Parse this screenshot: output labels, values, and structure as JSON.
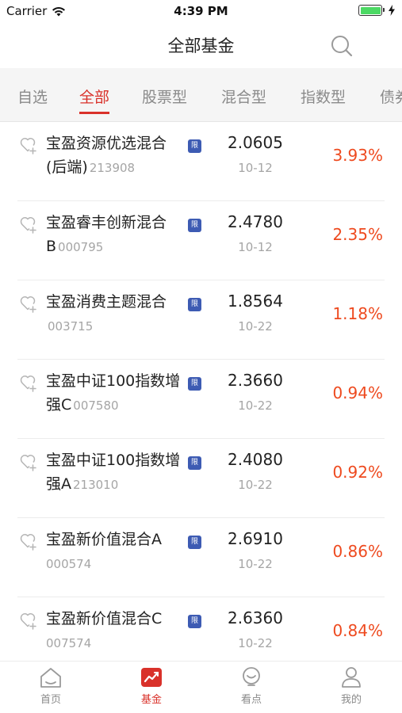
{
  "status_bar": {
    "carrier": "Carrier",
    "time": "4:39 PM"
  },
  "header": {
    "title": "全部基金"
  },
  "tabs": [
    {
      "label": "自选",
      "active": false
    },
    {
      "label": "全部",
      "active": true
    },
    {
      "label": "股票型",
      "active": false
    },
    {
      "label": "混合型",
      "active": false
    },
    {
      "label": "指数型",
      "active": false
    },
    {
      "label": "债券",
      "active": false
    }
  ],
  "funds": [
    {
      "name": "宝盈资源优选混合(后端)",
      "code": "213908",
      "badge": "限",
      "nav": "2.0605",
      "date": "10-12",
      "change": "3.93%"
    },
    {
      "name": "宝盈睿丰创新混合B",
      "code": "000795",
      "badge": "限",
      "nav": "2.4780",
      "date": "10-12",
      "change": "2.35%"
    },
    {
      "name": "宝盈消费主题混合",
      "code": "003715",
      "badge": "限",
      "nav": "1.8564",
      "date": "10-22",
      "change": "1.18%"
    },
    {
      "name": "宝盈中证100指数增强C",
      "code": "007580",
      "badge": "限",
      "nav": "2.3660",
      "date": "10-22",
      "change": "0.94%"
    },
    {
      "name": "宝盈中证100指数增强A",
      "code": "213010",
      "badge": "限",
      "nav": "2.4080",
      "date": "10-22",
      "change": "0.92%"
    },
    {
      "name": "宝盈新价值混合A",
      "code": "000574",
      "badge": "限",
      "nav": "2.6910",
      "date": "10-22",
      "change": "0.86%"
    },
    {
      "name": "宝盈新价值混合C",
      "code": "007574",
      "badge": "限",
      "nav": "2.6360",
      "date": "10-22",
      "change": "0.84%"
    }
  ],
  "tab_bar": [
    {
      "label": "首页",
      "icon": "home-icon",
      "active": false
    },
    {
      "label": "基金",
      "icon": "fund-chart-icon",
      "active": true
    },
    {
      "label": "看点",
      "icon": "bulb-icon",
      "active": false
    },
    {
      "label": "我的",
      "icon": "person-icon",
      "active": false
    }
  ],
  "colors": {
    "accent": "#d9312a",
    "change_positive": "#ee4a1f",
    "badge": "#3d5bb3"
  }
}
